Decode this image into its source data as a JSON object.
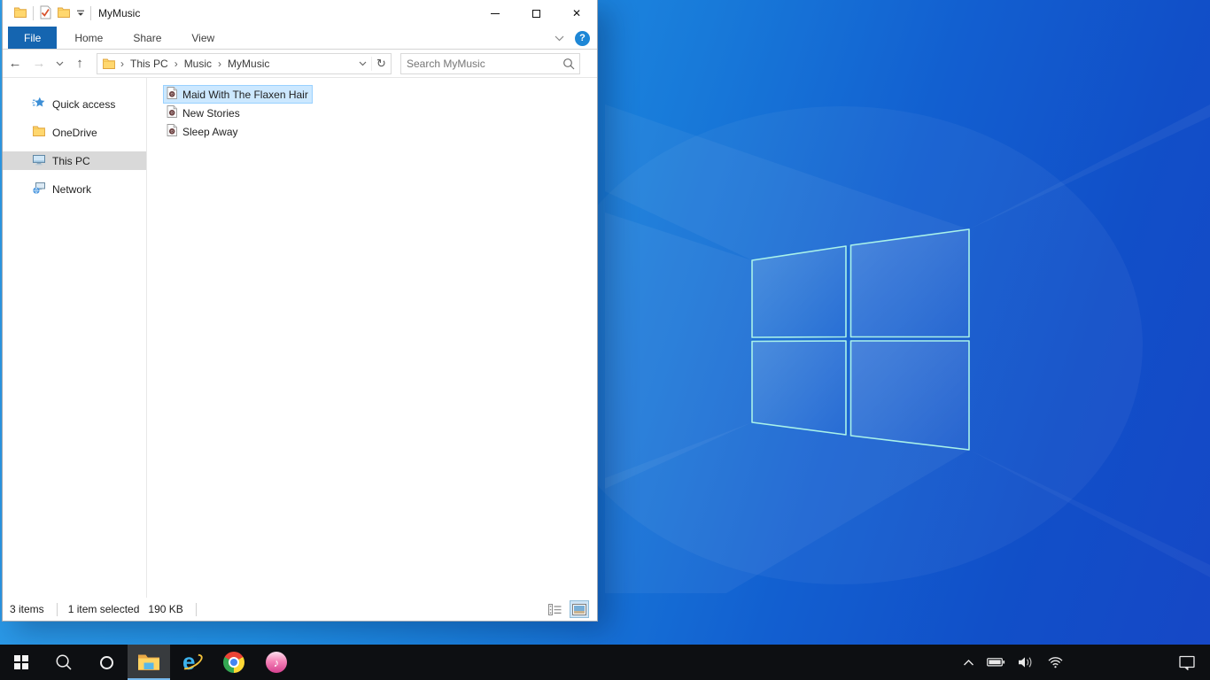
{
  "wallpaper": {
    "description": "Windows 10 light blue default wallpaper with glowing window logo",
    "base_colors": [
      "#2f9de8",
      "#187ad9",
      "#1647c6"
    ],
    "logo_stroke_color": "#a9f2ea"
  },
  "explorer": {
    "title": "MyMusic",
    "quick_access_toolbar": {
      "icons": [
        "explorer-folder-icon",
        "properties-icon",
        "new-folder-icon",
        "customize-quick-access-dropdown"
      ]
    },
    "window_controls": [
      "minimize",
      "maximize",
      "close"
    ],
    "ribbon": {
      "tabs": [
        {
          "label": "File",
          "active": true
        },
        {
          "label": "Home",
          "active": false
        },
        {
          "label": "Share",
          "active": false
        },
        {
          "label": "View",
          "active": false
        }
      ],
      "minimize_ribbon_icon": "chevron-down-icon",
      "help_icon": "help-icon"
    },
    "navigation_icons": [
      "back-icon",
      "forward-icon",
      "recent-locations-chevron-icon",
      "up-icon"
    ],
    "address": {
      "breadcrumb": [
        {
          "label": "This PC"
        },
        {
          "label": "Music"
        },
        {
          "label": "MyMusic"
        }
      ],
      "icons": [
        "folder-icon",
        "address-dropdown-chevron-icon",
        "refresh-icon"
      ]
    },
    "search": {
      "placeholder": "Search MyMusic",
      "icon": "search-icon"
    },
    "sidebar": {
      "items": [
        {
          "label": "Quick access",
          "icon": "quick-access-star-icon",
          "selected": false
        },
        {
          "label": "OneDrive",
          "icon": "folder-icon",
          "selected": false
        },
        {
          "label": "This PC",
          "icon": "computer-icon",
          "selected": true
        },
        {
          "label": "Network",
          "icon": "network-icon",
          "selected": false
        }
      ]
    },
    "files": [
      {
        "name": "Maid With The Flaxen Hair",
        "icon": "audio-file-icon",
        "selected": true
      },
      {
        "name": "New Stories",
        "icon": "audio-file-icon",
        "selected": false
      },
      {
        "name": "Sleep Away",
        "icon": "audio-file-icon",
        "selected": false
      }
    ],
    "statusbar": {
      "items_count": "3 items",
      "selected_info": "1 item selected",
      "selected_size": "190 KB",
      "view_icons": [
        "details-view-icon",
        "large-icons-view-icon"
      ],
      "active_view": "large-icons"
    }
  },
  "taskbar": {
    "buttons": [
      {
        "name": "start",
        "icon": "windows-logo-icon",
        "active": false
      },
      {
        "name": "search",
        "icon": "search-icon",
        "active": false
      },
      {
        "name": "cortana",
        "icon": "cortana-circle-icon",
        "active": false
      },
      {
        "name": "file-explorer",
        "icon": "file-explorer-folder-icon",
        "active": true
      },
      {
        "name": "internet-explorer",
        "icon": "internet-explorer-icon",
        "active": false
      },
      {
        "name": "chrome",
        "icon": "chrome-icon",
        "active": false
      },
      {
        "name": "itunes",
        "icon": "itunes-icon",
        "active": false
      }
    ],
    "tray_icons": [
      "chevron-up-icon",
      "battery-icon",
      "volume-icon",
      "wifi-icon"
    ],
    "action_center_icon": "action-center-icon"
  },
  "icons": {
    "close_glyph": "✕",
    "help_glyph": "?",
    "note_glyph": "♪",
    "breadcrumb_separator": "›",
    "back_glyph": "←",
    "forward_glyph": "→",
    "up_glyph": "↑",
    "refresh_glyph": "↻"
  },
  "colors": {
    "file_tab_blue": "#1565b0",
    "help_blue": "#1e87d6",
    "selection_fill": "#cce8ff",
    "selection_border": "#99d1ff",
    "sidebar_selected": "#d9d9d9",
    "taskbar_bg": "#0d0f12",
    "taskbar_active_underline": "#76b9ed"
  }
}
